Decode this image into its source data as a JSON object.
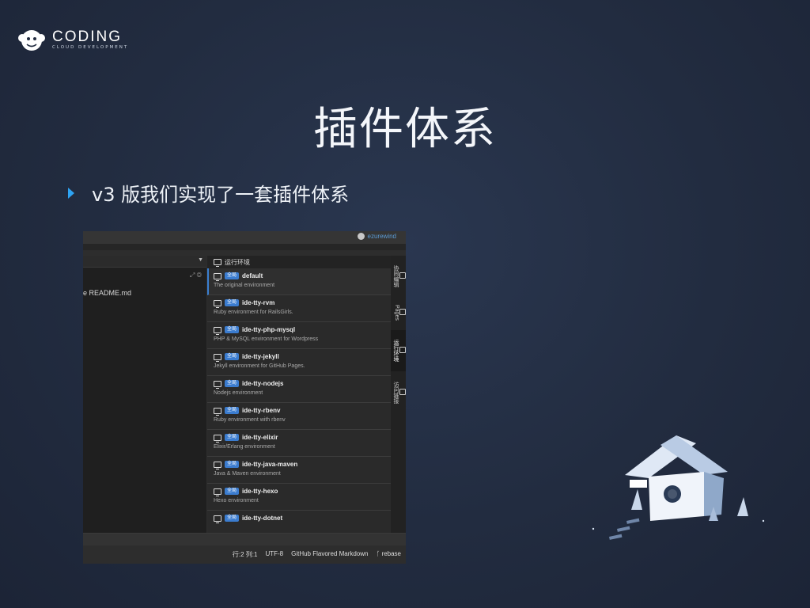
{
  "logo": {
    "word": "CODING",
    "sub": "CLOUD DEVELOPMENT"
  },
  "slide": {
    "title": "插件体系",
    "bullet": "v3 版我们实现了一套插件体系"
  },
  "ide": {
    "username": "ezurewind",
    "editor_file": "e README.md",
    "panel_title": "运行环境",
    "tag_label": "全局",
    "environments": [
      {
        "name": "default",
        "desc": "The original environment"
      },
      {
        "name": "ide-tty-rvm",
        "desc": "Ruby environment for RailsGirls."
      },
      {
        "name": "ide-tty-php-mysql",
        "desc": "PHP & MySQL environment for Wordpress"
      },
      {
        "name": "ide-tty-jekyll",
        "desc": "Jekyll environment for GitHub Pages."
      },
      {
        "name": "ide-tty-nodejs",
        "desc": "Nodejs environment"
      },
      {
        "name": "ide-tty-rbenv",
        "desc": "Ruby environment with rbenv"
      },
      {
        "name": "ide-tty-elixir",
        "desc": "Elixir/Erlang environment"
      },
      {
        "name": "ide-tty-java-maven",
        "desc": "Java & Maven environment"
      },
      {
        "name": "ide-tty-hexo",
        "desc": "Hexo environment"
      },
      {
        "name": "ide-tty-dotnet",
        "desc": ""
      }
    ],
    "side_tabs": [
      "协同编辑",
      "Pages",
      "运行环境",
      "访问链接"
    ],
    "status": {
      "position": "行:2 列:1",
      "encoding": "UTF-8",
      "mode": "GitHub Flavored Markdown",
      "branch": "rebase"
    }
  },
  "colors": {
    "accent": "#2ea3f2",
    "tag": "#3b7ccf",
    "background": "#222c40"
  }
}
